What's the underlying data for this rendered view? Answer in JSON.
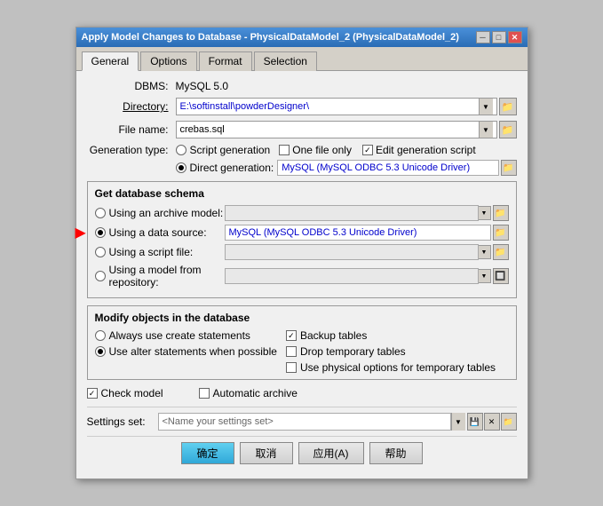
{
  "window": {
    "title": "Apply Model Changes to Database - PhysicalDataModel_2 (PhysicalDataModel_2)",
    "minimize_label": "─",
    "maximize_label": "□",
    "close_label": "✕"
  },
  "tabs": [
    {
      "label": "General",
      "active": true
    },
    {
      "label": "Options",
      "active": false
    },
    {
      "label": "Format",
      "active": false
    },
    {
      "label": "Selection",
      "active": false
    }
  ],
  "form": {
    "dbms_label": "DBMS:",
    "dbms_value": "MySQL 5.0",
    "directory_label": "Directory:",
    "directory_value": "E:\\softinstall\\powderDesigner\\",
    "filename_label": "File name:",
    "filename_value": "crebas.sql",
    "gentype_label": "Generation type:",
    "script_gen_label": "Script generation",
    "one_file_label": "One file only",
    "edit_script_label": "Edit generation script",
    "direct_gen_label": "Direct generation:",
    "direct_gen_value": "MySQL (MySQL ODBC 5.3 Unicode Driver)",
    "schema_section_title": "Get database schema",
    "archive_label": "Using an archive model:",
    "datasource_label": "Using a data source:",
    "datasource_value": "MySQL (MySQL ODBC 5.3 Unicode Driver)",
    "scriptfile_label": "Using a script file:",
    "repository_label": "Using a model from repository:",
    "modify_section_title": "Modify objects in the database",
    "always_create_label": "Always use create statements",
    "backup_tables_label": "Backup tables",
    "alter_statements_label": "Use alter statements when possible",
    "drop_temp_label": "Drop temporary tables",
    "phys_options_label": "Use physical options for temporary tables",
    "check_model_label": "Check model",
    "auto_archive_label": "Automatic archive",
    "settings_label": "Settings set:",
    "settings_value": "<Name your settings set>",
    "btn_ok": "确定",
    "btn_cancel": "取消",
    "btn_apply": "应用(A)",
    "btn_help": "帮助"
  },
  "icons": {
    "folder": "📁",
    "arrow_down": "▼",
    "save": "💾",
    "delete": "✕",
    "arrow_right": "▶"
  }
}
